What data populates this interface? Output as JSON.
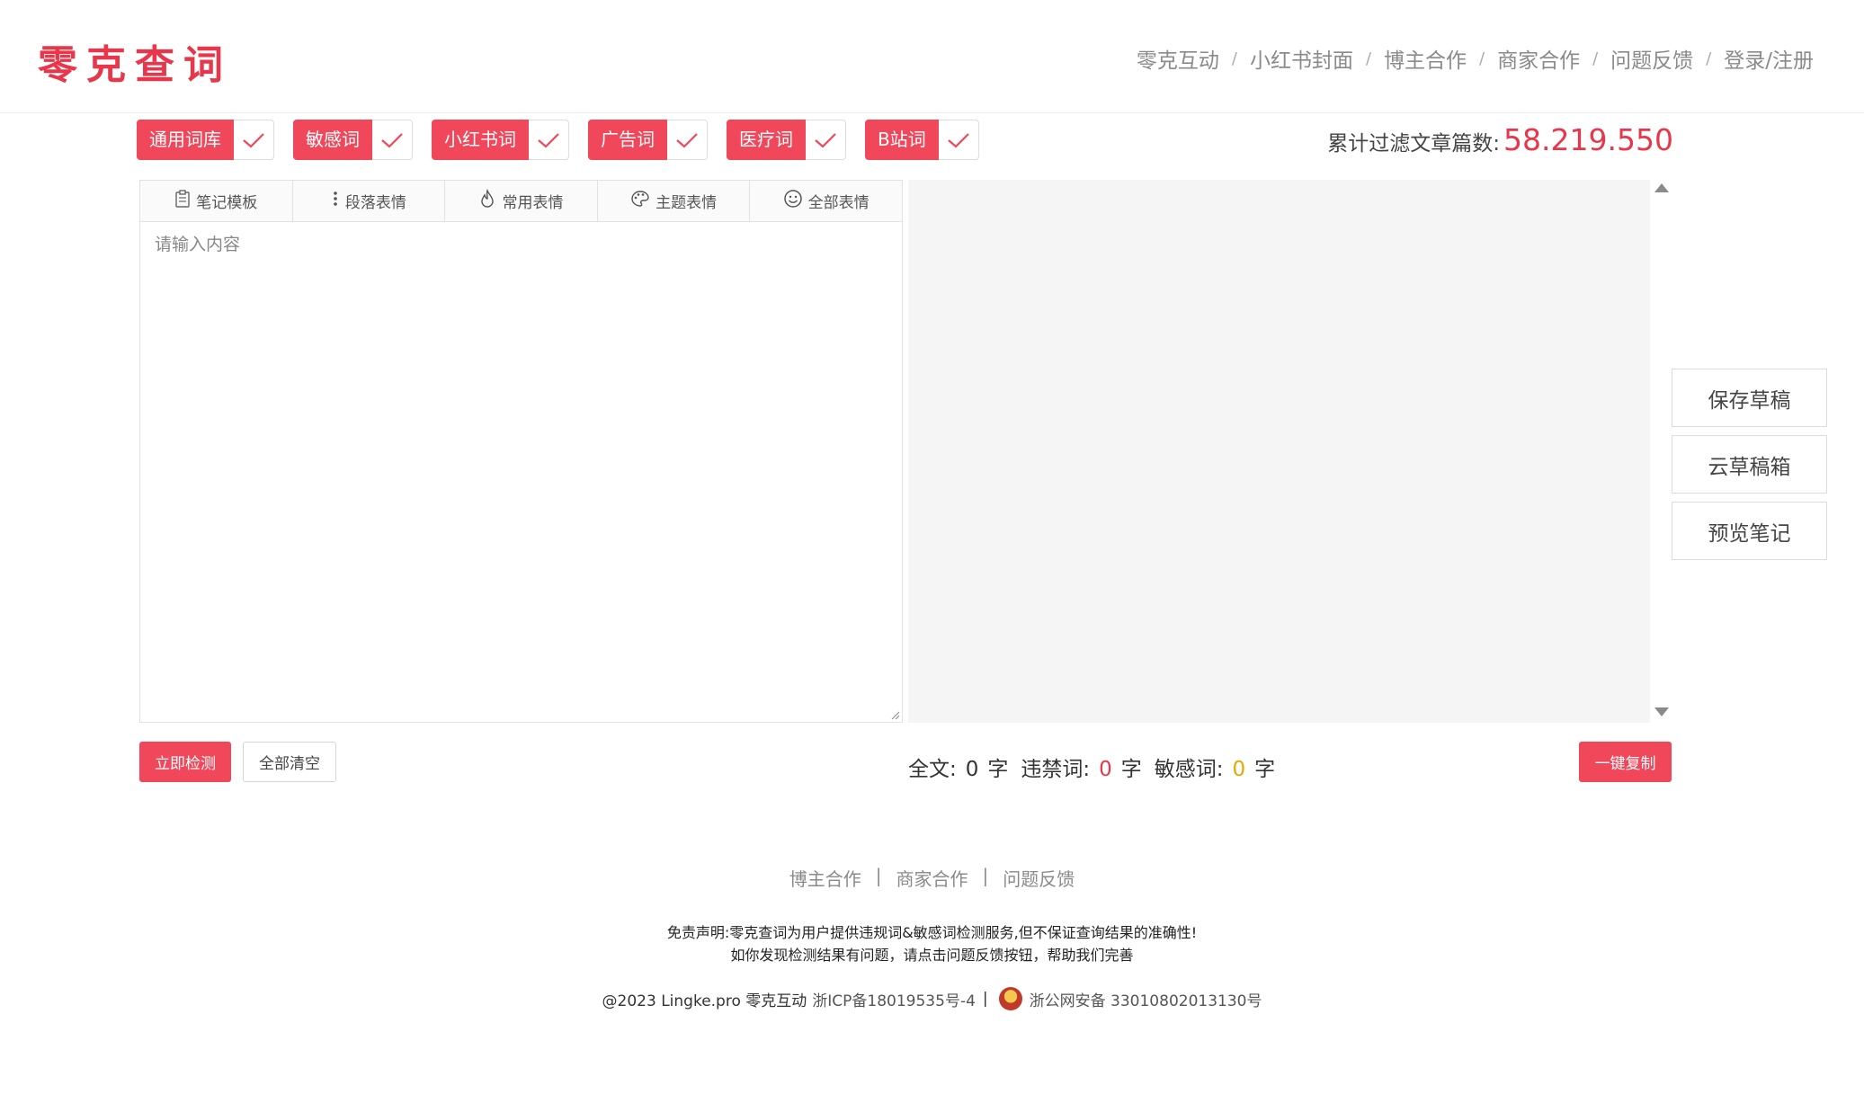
{
  "header": {
    "logo": "零克查词",
    "nav": [
      "零克互动",
      "小红书封面",
      "博主合作",
      "商家合作",
      "问题反馈",
      "登录/注册"
    ],
    "nav_separator": "/"
  },
  "tags": [
    {
      "label": "通用词库",
      "checked": true
    },
    {
      "label": "敏感词",
      "checked": true
    },
    {
      "label": "小红书词",
      "checked": true
    },
    {
      "label": "广告词",
      "checked": true
    },
    {
      "label": "医疗词",
      "checked": true
    },
    {
      "label": "B站词",
      "checked": true
    }
  ],
  "counter": {
    "label": "累计过滤文章篇数:",
    "value": "58.219.550"
  },
  "editor": {
    "tools": [
      {
        "label": "笔记模板",
        "icon": "clipboard-icon"
      },
      {
        "label": "段落表情",
        "icon": "vertical-dots-icon"
      },
      {
        "label": "常用表情",
        "icon": "flame-icon"
      },
      {
        "label": "主题表情",
        "icon": "palette-icon"
      },
      {
        "label": "全部表情",
        "icon": "smiley-icon"
      }
    ],
    "placeholder": "请输入内容",
    "value": ""
  },
  "side_buttons": [
    "保存草稿",
    "云草稿箱",
    "预览笔记"
  ],
  "actions": {
    "check": "立即检测",
    "clear": "全部清空",
    "copy": "一键复制"
  },
  "stats": {
    "full_label": "全文:",
    "full_count": "0",
    "prohibited_label": "违禁词:",
    "prohibited_count": "0",
    "sensitive_label": "敏感词:",
    "sensitive_count": "0",
    "unit": "字"
  },
  "footer": {
    "links": [
      "博主合作",
      "商家合作",
      "问题反馈"
    ],
    "link_separator": "|",
    "disclaimer_1": "免责声明:零克查词为用户提供违规词&敏感词检测服务,但不保证查询结果的准确性!",
    "disclaimer_2": "如你发现检测结果有问题，请点击问题反馈按钮，帮助我们完善",
    "copyright": "@2023 Lingke.pro 零克互动",
    "icp": "浙ICP备18019535号-4",
    "icp_separator": "|",
    "police": "浙公网安备 33010802013130号"
  },
  "colors": {
    "accent": "#f0475b",
    "logo": "#e8364a",
    "warning": "#e8a800"
  }
}
